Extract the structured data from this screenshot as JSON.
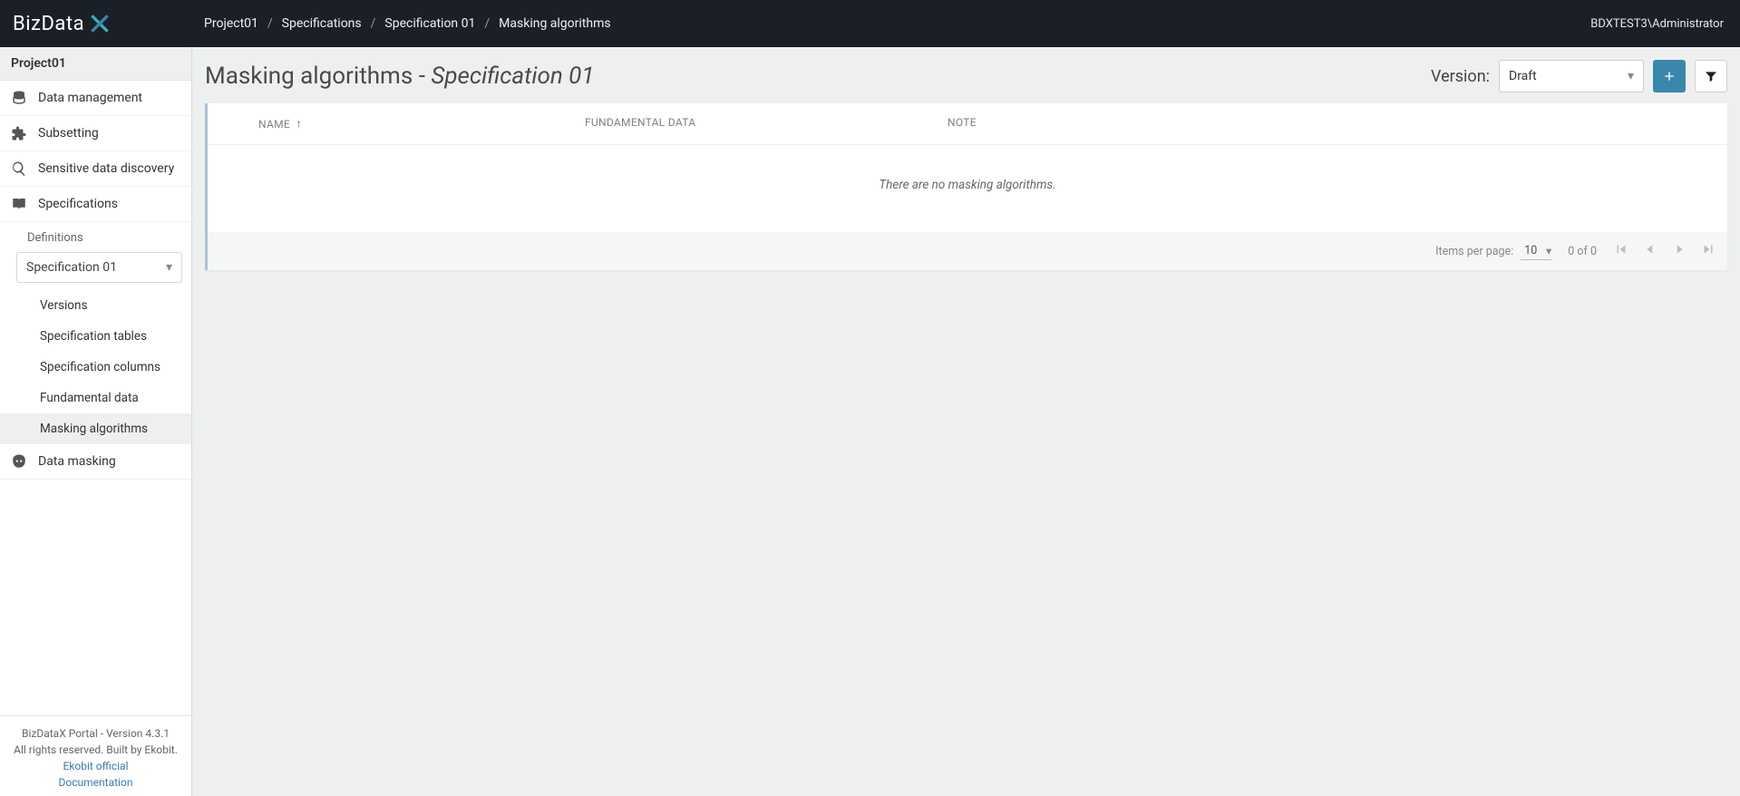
{
  "logo_text": "BizData",
  "breadcrumbs": [
    "Project01",
    "Specifications",
    "Specification 01",
    "Masking algorithms"
  ],
  "user": "BDXTEST3\\Administrator",
  "sidebar": {
    "project": "Project01",
    "items": [
      {
        "label": "Data management"
      },
      {
        "label": "Subsetting"
      },
      {
        "label": "Sensitive data discovery"
      },
      {
        "label": "Specifications"
      }
    ],
    "definitions_label": "Definitions",
    "spec_select": "Specification 01",
    "sub_items": [
      {
        "label": "Versions"
      },
      {
        "label": "Specification tables"
      },
      {
        "label": "Specification columns"
      },
      {
        "label": "Fundamental data"
      },
      {
        "label": "Masking algorithms",
        "active": true
      }
    ],
    "data_masking": "Data masking"
  },
  "footer": {
    "line1": "BizDataX Portal - Version 4.3.1",
    "line2": "All rights reserved. Built by Ekobit.",
    "link1": "Ekobit official",
    "link2": "Documentation"
  },
  "page": {
    "title_main": "Masking algorithms",
    "title_sep": " - ",
    "title_em": "Specification 01",
    "version_label": "Version:",
    "version_value": "Draft"
  },
  "table": {
    "columns": {
      "name": "NAME",
      "fd": "FUNDAMENTAL DATA",
      "note": "NOTE"
    },
    "empty": "There are no masking algorithms.",
    "items_per_page_label": "Items per page:",
    "items_per_page_value": "10",
    "range": "0 of 0"
  }
}
